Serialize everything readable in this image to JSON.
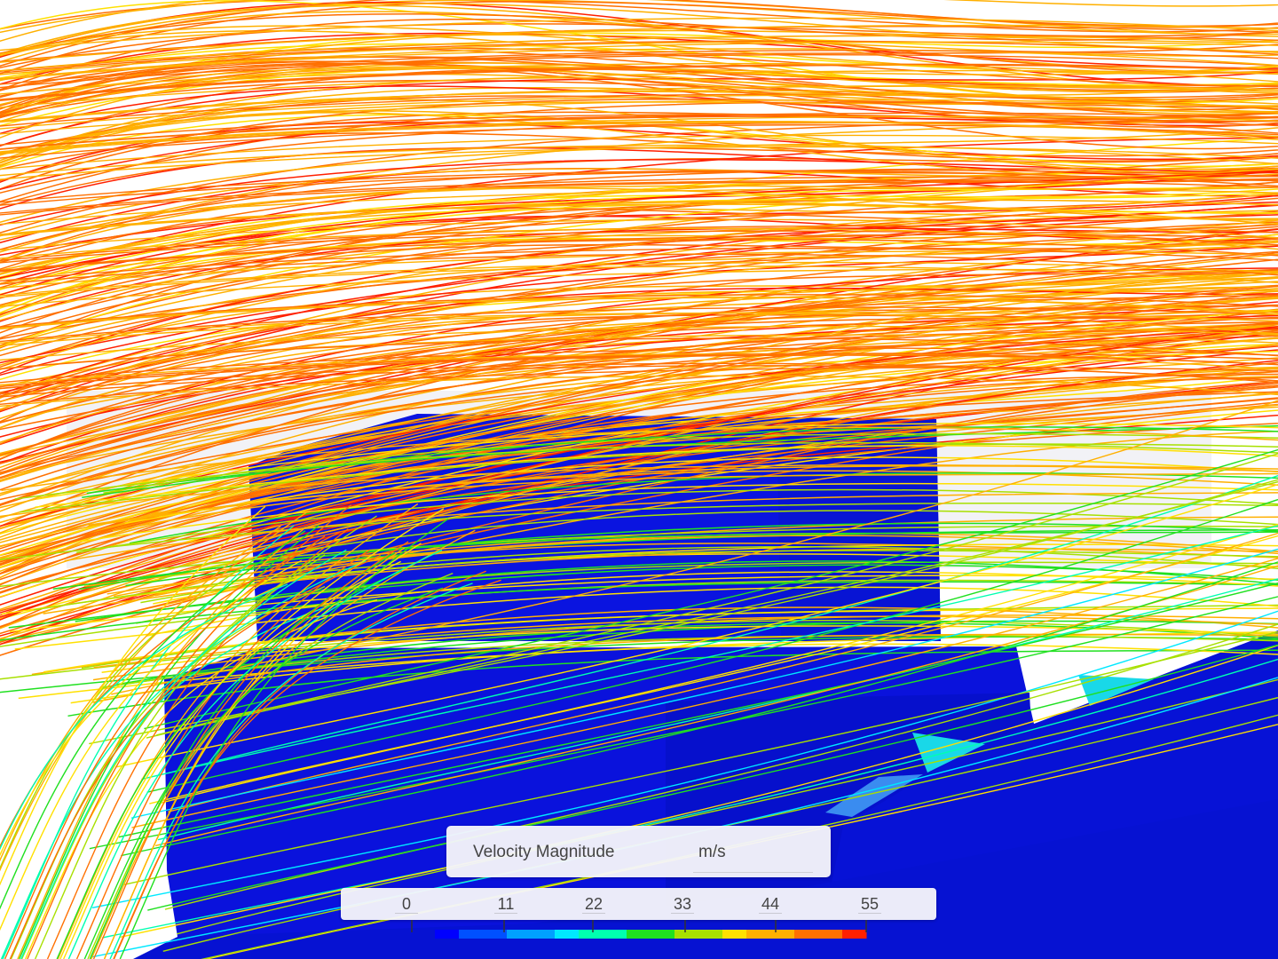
{
  "legend": {
    "title": "Velocity Magnitude",
    "unit": "m/s",
    "ticks": [
      "0",
      "11",
      "22",
      "33",
      "44",
      "55"
    ],
    "min": 0,
    "max": 55
  },
  "colormap": [
    "#0000ff",
    "#0050ff",
    "#00a0ff",
    "#00e8ff",
    "#00ffb0",
    "#20e020",
    "#a8e000",
    "#ffe000",
    "#ffb000",
    "#ff7000",
    "#ff2000"
  ],
  "colors": {
    "background": "#ffffff",
    "geometry": "#0a14d8",
    "legend_panel": "#f5f5fa"
  }
}
